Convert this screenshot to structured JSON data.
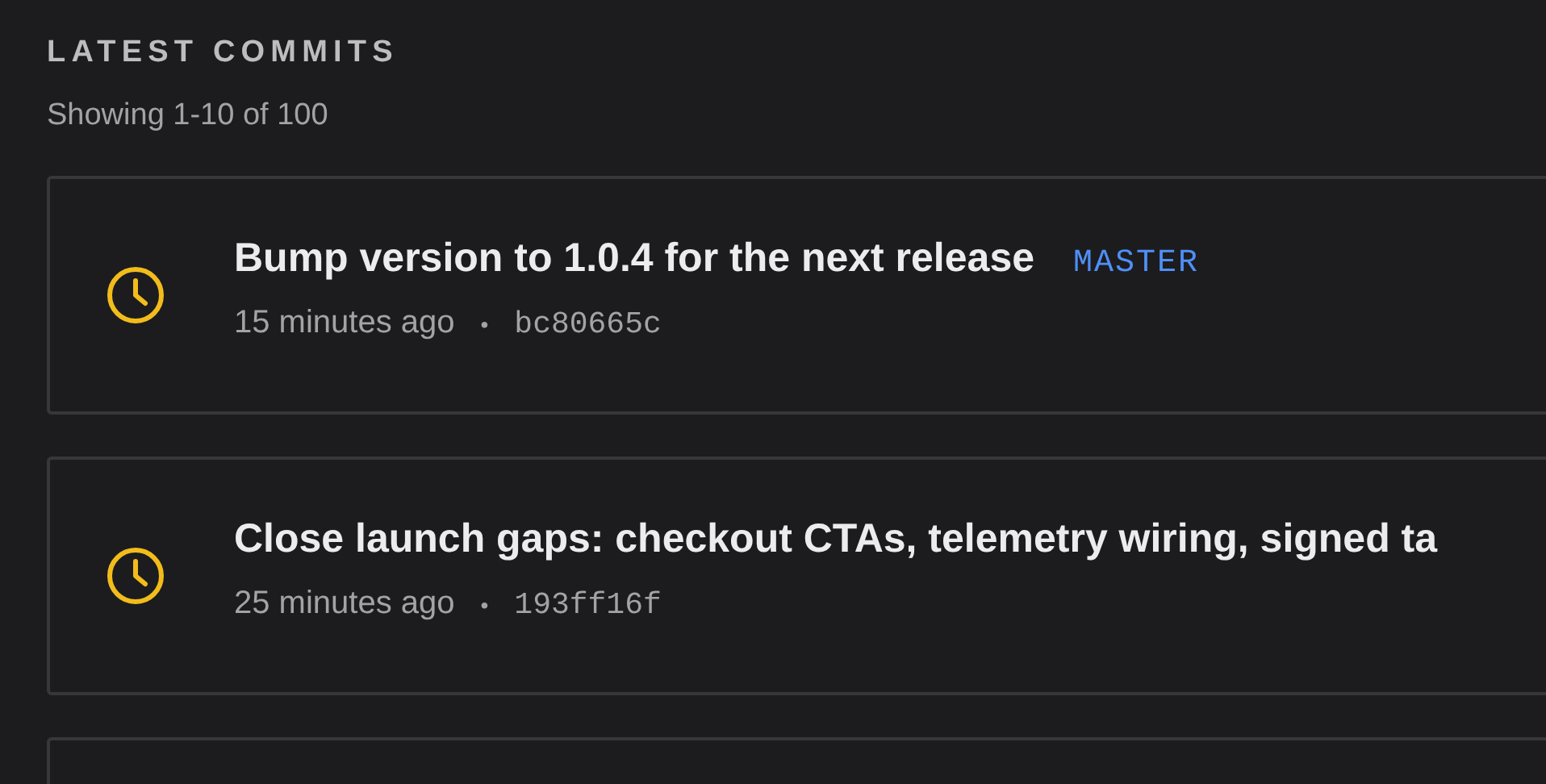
{
  "section": {
    "title": "LATEST COMMITS",
    "summary": "Showing 1-10 of 100"
  },
  "commits": [
    {
      "message": "Bump version to 1.0.4 for the next release",
      "branch": "MASTER",
      "time": "15 minutes ago",
      "separator": "•",
      "hash": "bc80665c"
    },
    {
      "message": "Close launch gaps: checkout CTAs, telemetry wiring, signed ta",
      "time": "25 minutes ago",
      "separator": "•",
      "hash": "193ff16f"
    }
  ]
}
